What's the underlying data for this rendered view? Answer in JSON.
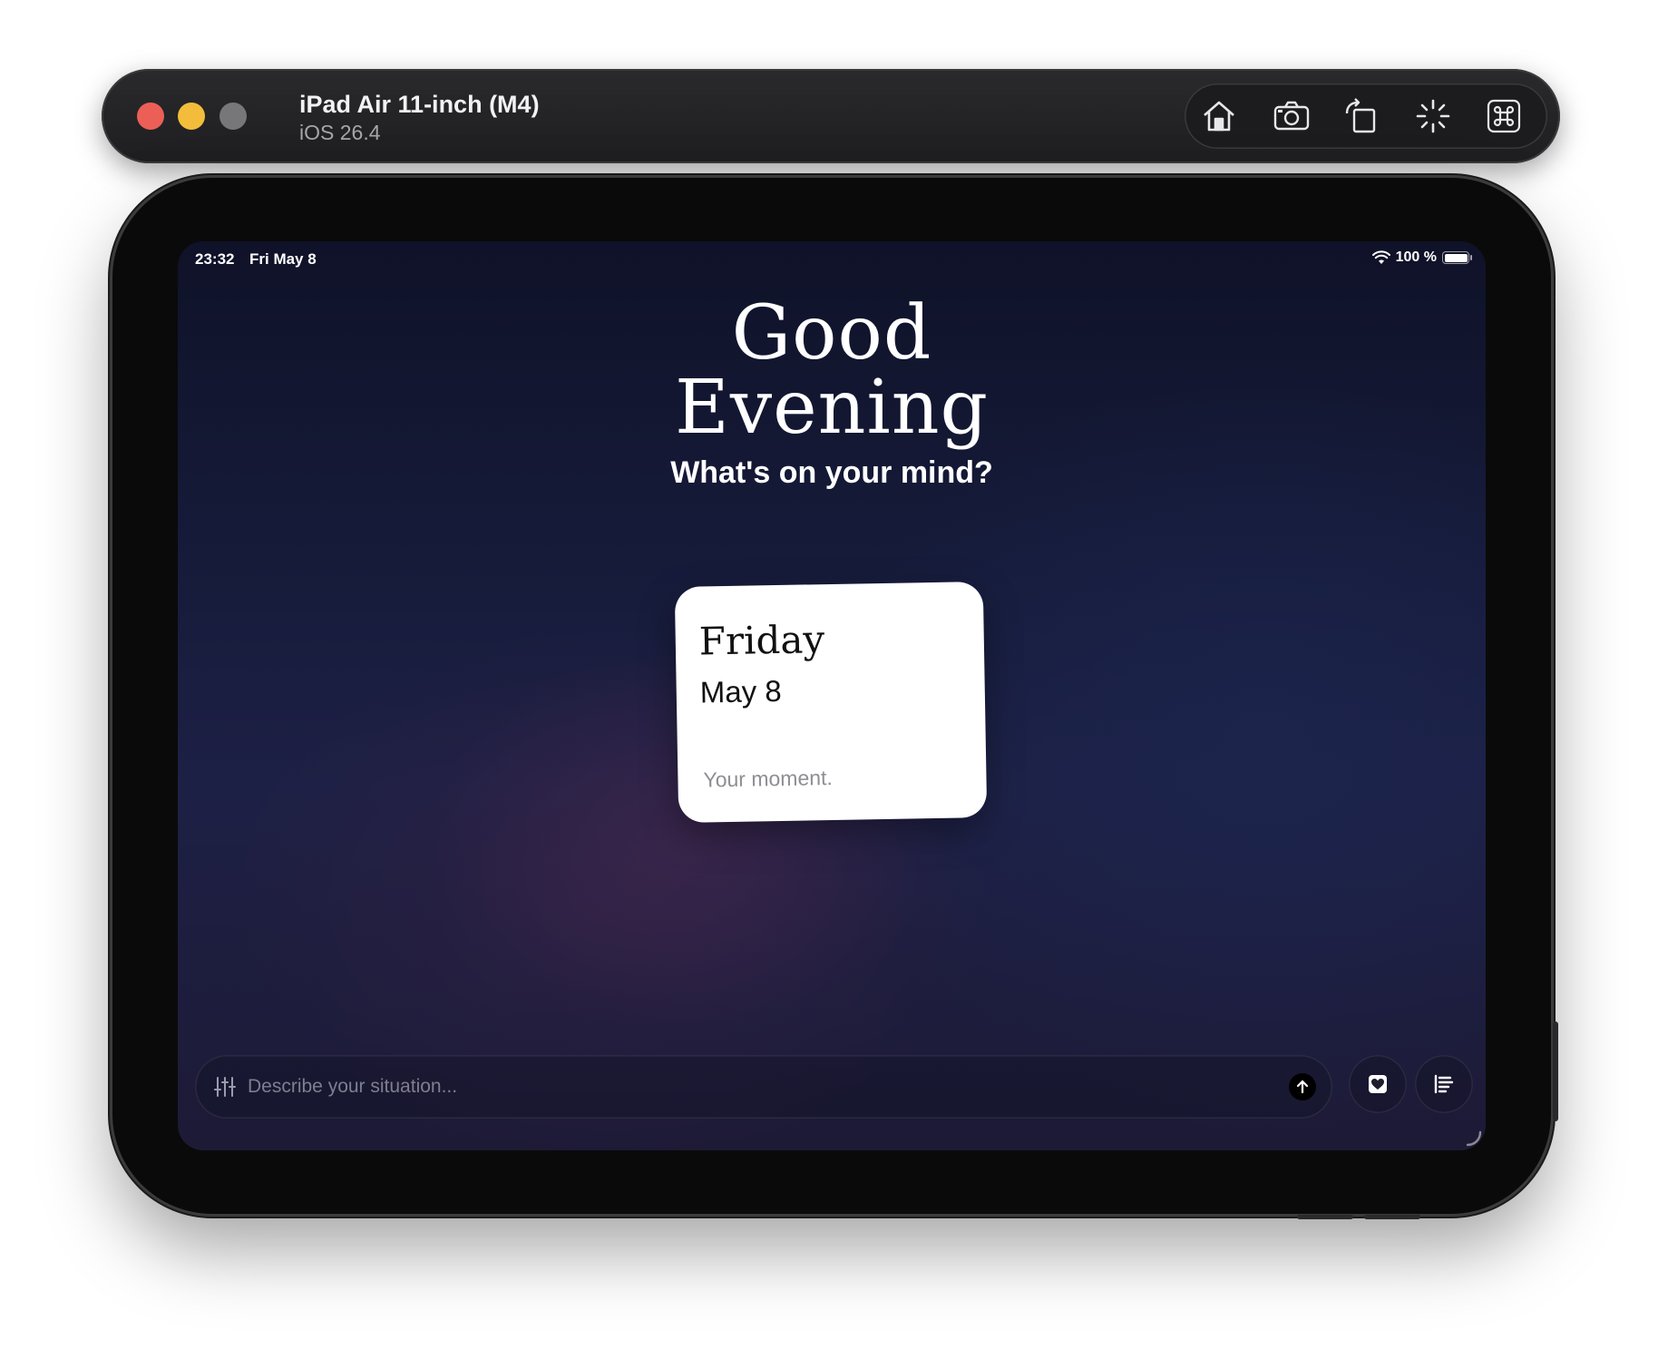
{
  "simulator": {
    "device_name": "iPad Air 11-inch (M4)",
    "os_version": "iOS 26.4",
    "toolbar_icons": [
      "home-icon",
      "screenshot-icon",
      "rotate-icon",
      "shake-icon",
      "command-icon"
    ]
  },
  "status_bar": {
    "time": "23:32",
    "date": "Fri May 8",
    "battery_text": "100 %",
    "battery_level": 1.0
  },
  "greeting": {
    "line1": "Good",
    "line2": "Evening",
    "subtitle": "What's on your mind?"
  },
  "day_card": {
    "weekday": "Friday",
    "date": "May 8",
    "caption": "Your moment."
  },
  "composer": {
    "placeholder": "Describe your situation...",
    "value": ""
  },
  "colors": {
    "background_top": "#0f1228",
    "background_bottom": "#1d1a36",
    "card": "#ffffff",
    "traffic_red": "#ec5f57",
    "traffic_yellow": "#f3bd3b",
    "traffic_gray": "#77777a"
  }
}
